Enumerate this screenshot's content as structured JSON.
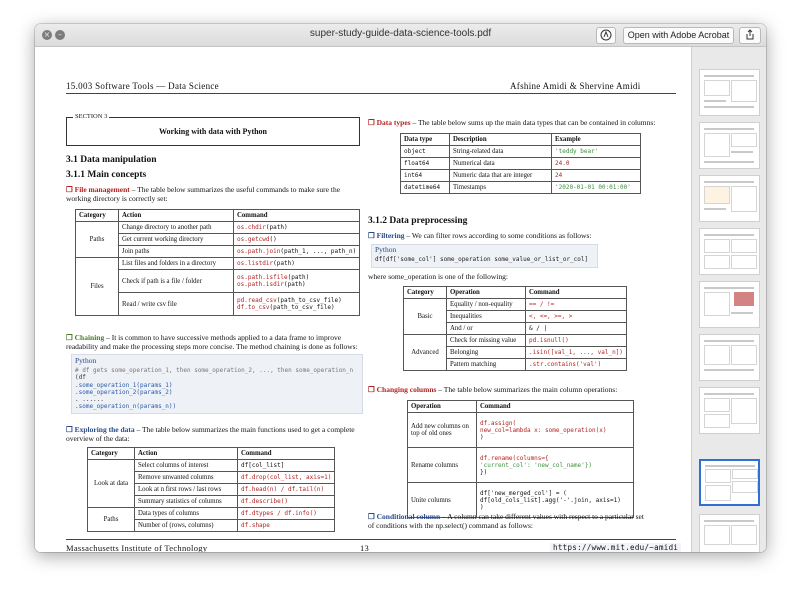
{
  "window": {
    "title": "super-study-guide-data-science-tools.pdf",
    "acrobat_button": "Open with Adobe Acrobat"
  },
  "page": {
    "header_left": "15.003 Software Tools — Data Science",
    "header_right": "Afshine Amidi & Shervine Amidi",
    "footer_left": "Massachusetts Institute of Technology",
    "footer_page": "13",
    "footer_url": "https://www.mit.edu/~amidi"
  },
  "left": {
    "section_label": "SECTION 3",
    "section_title": "Working with data with Python",
    "h31": "3.1   Data manipulation",
    "h311": "3.1.1   Main concepts",
    "fm_label": "File management",
    "fm_text": " – The table below summarizes the useful commands to make sure the",
    "fm_text2": "working directory is correctly set:",
    "fm_headers": [
      "Category",
      "Action",
      "Command"
    ],
    "fm_paths_cat": "Paths",
    "fm_files_cat": "Files",
    "fm_rows": [
      {
        "action": "Change directory to another path",
        "cmd_a": "os.",
        "cmd_b": "chdir",
        "cmd_c": "(path)"
      },
      {
        "action": "Get current working directory",
        "cmd_a": "os.",
        "cmd_b": "getcwd",
        "cmd_c": "()"
      },
      {
        "action": "Join paths",
        "cmd_a": "os.path.",
        "cmd_b": "join",
        "cmd_c": "(path_1, ..., path_n)"
      },
      {
        "action": "List files and folders in a directory",
        "cmd_a": "os.",
        "cmd_b": "listdir",
        "cmd_c": "(path)"
      },
      {
        "action": "Check if path is a file / folder",
        "cmd_a": "os.path.",
        "cmd_b": "isfile",
        "cmd_c": "(path)",
        "cmd2_a": "os.path.",
        "cmd2_b": "isdir",
        "cmd2_c": "(path)"
      },
      {
        "action": "Read / write csv file",
        "cmd_a": "pd.",
        "cmd_b": "read_csv",
        "cmd_c": "(path_to_csv_file)",
        "cmd2_a": "df.",
        "cmd2_b": "to_csv",
        "cmd2_c": "(path_to_csv_file)"
      }
    ],
    "ch_label": "Chaining",
    "ch_text": " – It is common to have successive methods applied to a data frame to improve",
    "ch_text2": "readability and make the processing steps more concise. The method chaining is done as follows:",
    "py_label": "Python",
    "chain_code": [
      "# df gets some_operation_1, then some_operation_2, ..., then some_operation_n",
      "(df",
      " .some_operation_1(params_1)",
      " .some_operation_2(params_2)",
      " . ......",
      " .some_operation_n(params_n))"
    ],
    "ex_label": "Exploring the data",
    "ex_text": " – The table below summarizes the main functions used to get a complete",
    "ex_text2": "overview of the data:",
    "ex_headers": [
      "Category",
      "Action",
      "Command"
    ],
    "ex_look_cat": "Look at data",
    "ex_paths_cat": "Paths",
    "ex_rows": [
      {
        "action": "Select columns of interest",
        "cmd": "df[col_list]"
      },
      {
        "action": "Remove unwanted columns",
        "cmd": "df.drop(col_list, axis=1)"
      },
      {
        "action": "Look at n first rows / last rows",
        "cmd": "df.head(n) / df.tail(n)"
      },
      {
        "action": "Summary statistics of columns",
        "cmd": "df.describe()"
      },
      {
        "action": "Data types of columns",
        "cmd": "df.dtypes / df.info()"
      },
      {
        "action": "Number of (rows, columns)",
        "cmd": "df.shape"
      }
    ]
  },
  "right": {
    "dt_label": "Data types",
    "dt_text": " – The table below sums up the main data types that can be contained in columns:",
    "dt_headers": [
      "Data type",
      "Description",
      "Example"
    ],
    "dt_rows": [
      {
        "type": "object",
        "desc": "String-related data",
        "ex": "'teddy bear'"
      },
      {
        "type": "float64",
        "desc": "Numerical data",
        "ex": "24.0"
      },
      {
        "type": "int64",
        "desc": "Numeric data that are integer",
        "ex": "24"
      },
      {
        "type": "datetime64",
        "desc": "Timestamps",
        "ex": "'2020-01-01 00:01:00'"
      }
    ],
    "h312": "3.1.2   Data preprocessing",
    "fi_label": "Filtering",
    "fi_text": " – We can filter rows according to some conditions as follows:",
    "py_label": "Python",
    "filter_code": "df[df['some_col'] some_operation some_value_or_list_or_col]",
    "where_text": "where some_operation is one of the following:",
    "op_headers": [
      "Category",
      "Operation",
      "Command"
    ],
    "op_basic": "Basic",
    "op_adv": "Advanced",
    "op_rows": [
      {
        "op": "Equality / non-equality",
        "cmd": "== / !="
      },
      {
        "op": "Inequalities",
        "cmd": "<, <=, >=, >"
      },
      {
        "op": "And / or",
        "cmd": "& / |"
      },
      {
        "op": "Check for missing value",
        "cmd": "pd.isnull()"
      },
      {
        "op": "Belonging",
        "cmd": ".isin([val_1, ..., val_n])"
      },
      {
        "op": "Pattern matching",
        "cmd": ".str.contains('val')"
      }
    ],
    "cc_label": "Changing columns",
    "cc_text": " – The table below summarizes the main column operations:",
    "cc_headers": [
      "Operation",
      "Command"
    ],
    "cc_rows": [
      {
        "op": "Add new columns on top of old ones",
        "c1": "df.assign(",
        "c2": "  new_col=lambda x: some_operation(x)",
        "c3": ")"
      },
      {
        "op": "Rename columns",
        "c1": "df.rename(columns={",
        "c2": "  'current_col': 'new_col_name'})",
        "c3": "})"
      },
      {
        "op": "Unite columns",
        "c1": "df['new_merged_col'] = (",
        "c2": "  df[old_cols_list].agg('-'.join, axis=1)",
        "c3": ")"
      }
    ],
    "cond_label": "Conditional column",
    "cond_text": " – A column can take different values with respect to a particular set",
    "cond_text2": "of conditions with the np.select() command as follows:"
  }
}
